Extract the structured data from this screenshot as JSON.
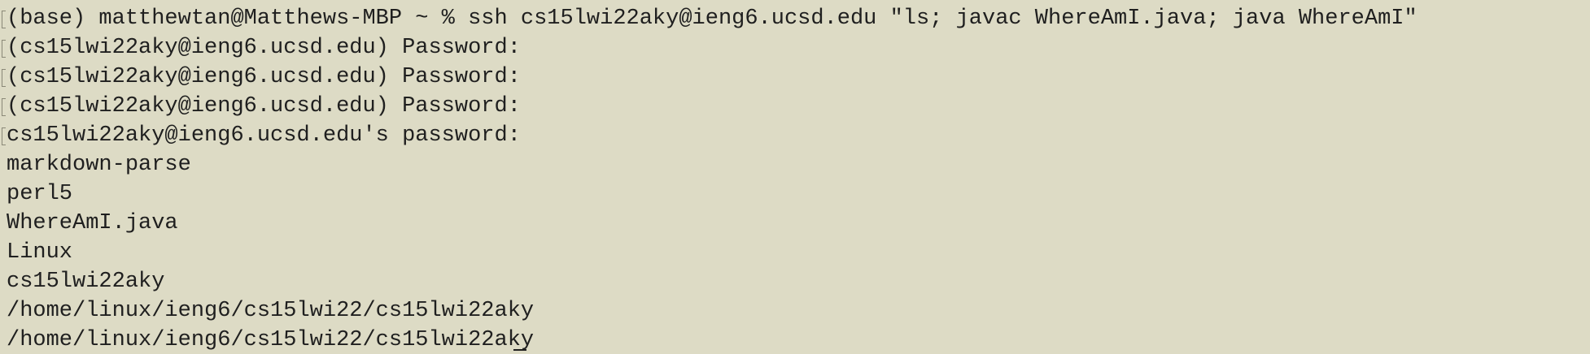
{
  "terminal": {
    "lines": [
      {
        "text": "(base) matthewtan@Matthews-MBP ~ % ssh cs15lwi22aky@ieng6.ucsd.edu \"ls; javac WhereAmI.java; java WhereAmI\"",
        "marked": true
      },
      {
        "text": "(cs15lwi22aky@ieng6.ucsd.edu) Password:",
        "marked": true
      },
      {
        "text": "(cs15lwi22aky@ieng6.ucsd.edu) Password:",
        "marked": true
      },
      {
        "text": "(cs15lwi22aky@ieng6.ucsd.edu) Password:",
        "marked": true
      },
      {
        "text": "cs15lwi22aky@ieng6.ucsd.edu's password:",
        "marked": true
      },
      {
        "text": "markdown-parse",
        "marked": false
      },
      {
        "text": "perl5",
        "marked": false
      },
      {
        "text": "WhereAmI.java",
        "marked": false
      },
      {
        "text": "Linux",
        "marked": false
      },
      {
        "text": "cs15lwi22aky",
        "marked": false
      },
      {
        "text": "/home/linux/ieng6/cs15lwi22/cs15lwi22aky",
        "marked": false
      },
      {
        "text": "/home/linux/ieng6/cs15lwi22/cs15lwi22aky",
        "marked": false
      }
    ]
  }
}
